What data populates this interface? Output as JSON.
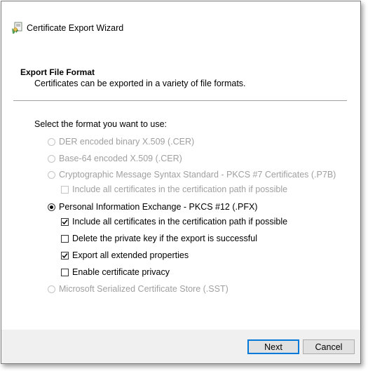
{
  "window": {
    "title": "Certificate Export Wizard"
  },
  "header": {
    "title": "Export File Format",
    "subtitle": "Certificates can be exported in a variety of file formats."
  },
  "main": {
    "prompt": "Select the format you want to use:",
    "options": [
      {
        "label": "DER encoded binary X.509 (.CER)",
        "type": "radio",
        "selected": false,
        "enabled": false
      },
      {
        "label": "Base-64 encoded X.509 (.CER)",
        "type": "radio",
        "selected": false,
        "enabled": false
      },
      {
        "label": "Cryptographic Message Syntax Standard - PKCS #7 Certificates (.P7B)",
        "type": "radio",
        "selected": false,
        "enabled": false
      },
      {
        "label": "Include all certificates in the certification path if possible",
        "type": "checkbox",
        "checked": false,
        "enabled": false
      },
      {
        "label": "Personal Information Exchange - PKCS #12 (.PFX)",
        "type": "radio",
        "selected": true,
        "enabled": true
      },
      {
        "label": "Include all certificates in the certification path if possible",
        "type": "checkbox",
        "checked": true,
        "enabled": true
      },
      {
        "label": "Delete the private key if the export is successful",
        "type": "checkbox",
        "checked": false,
        "enabled": true
      },
      {
        "label": "Export all extended properties",
        "type": "checkbox",
        "checked": true,
        "enabled": true
      },
      {
        "label": "Enable certificate privacy",
        "type": "checkbox",
        "checked": false,
        "enabled": true
      },
      {
        "label": "Microsoft Serialized Certificate Store (.SST)",
        "type": "radio",
        "selected": false,
        "enabled": false
      }
    ]
  },
  "footer": {
    "next_label": "Next",
    "cancel_label": "Cancel"
  },
  "colors": {
    "accent": "#0078d7",
    "disabled_text": "#a0a0a0",
    "footer_bg": "#f0f0f0"
  }
}
